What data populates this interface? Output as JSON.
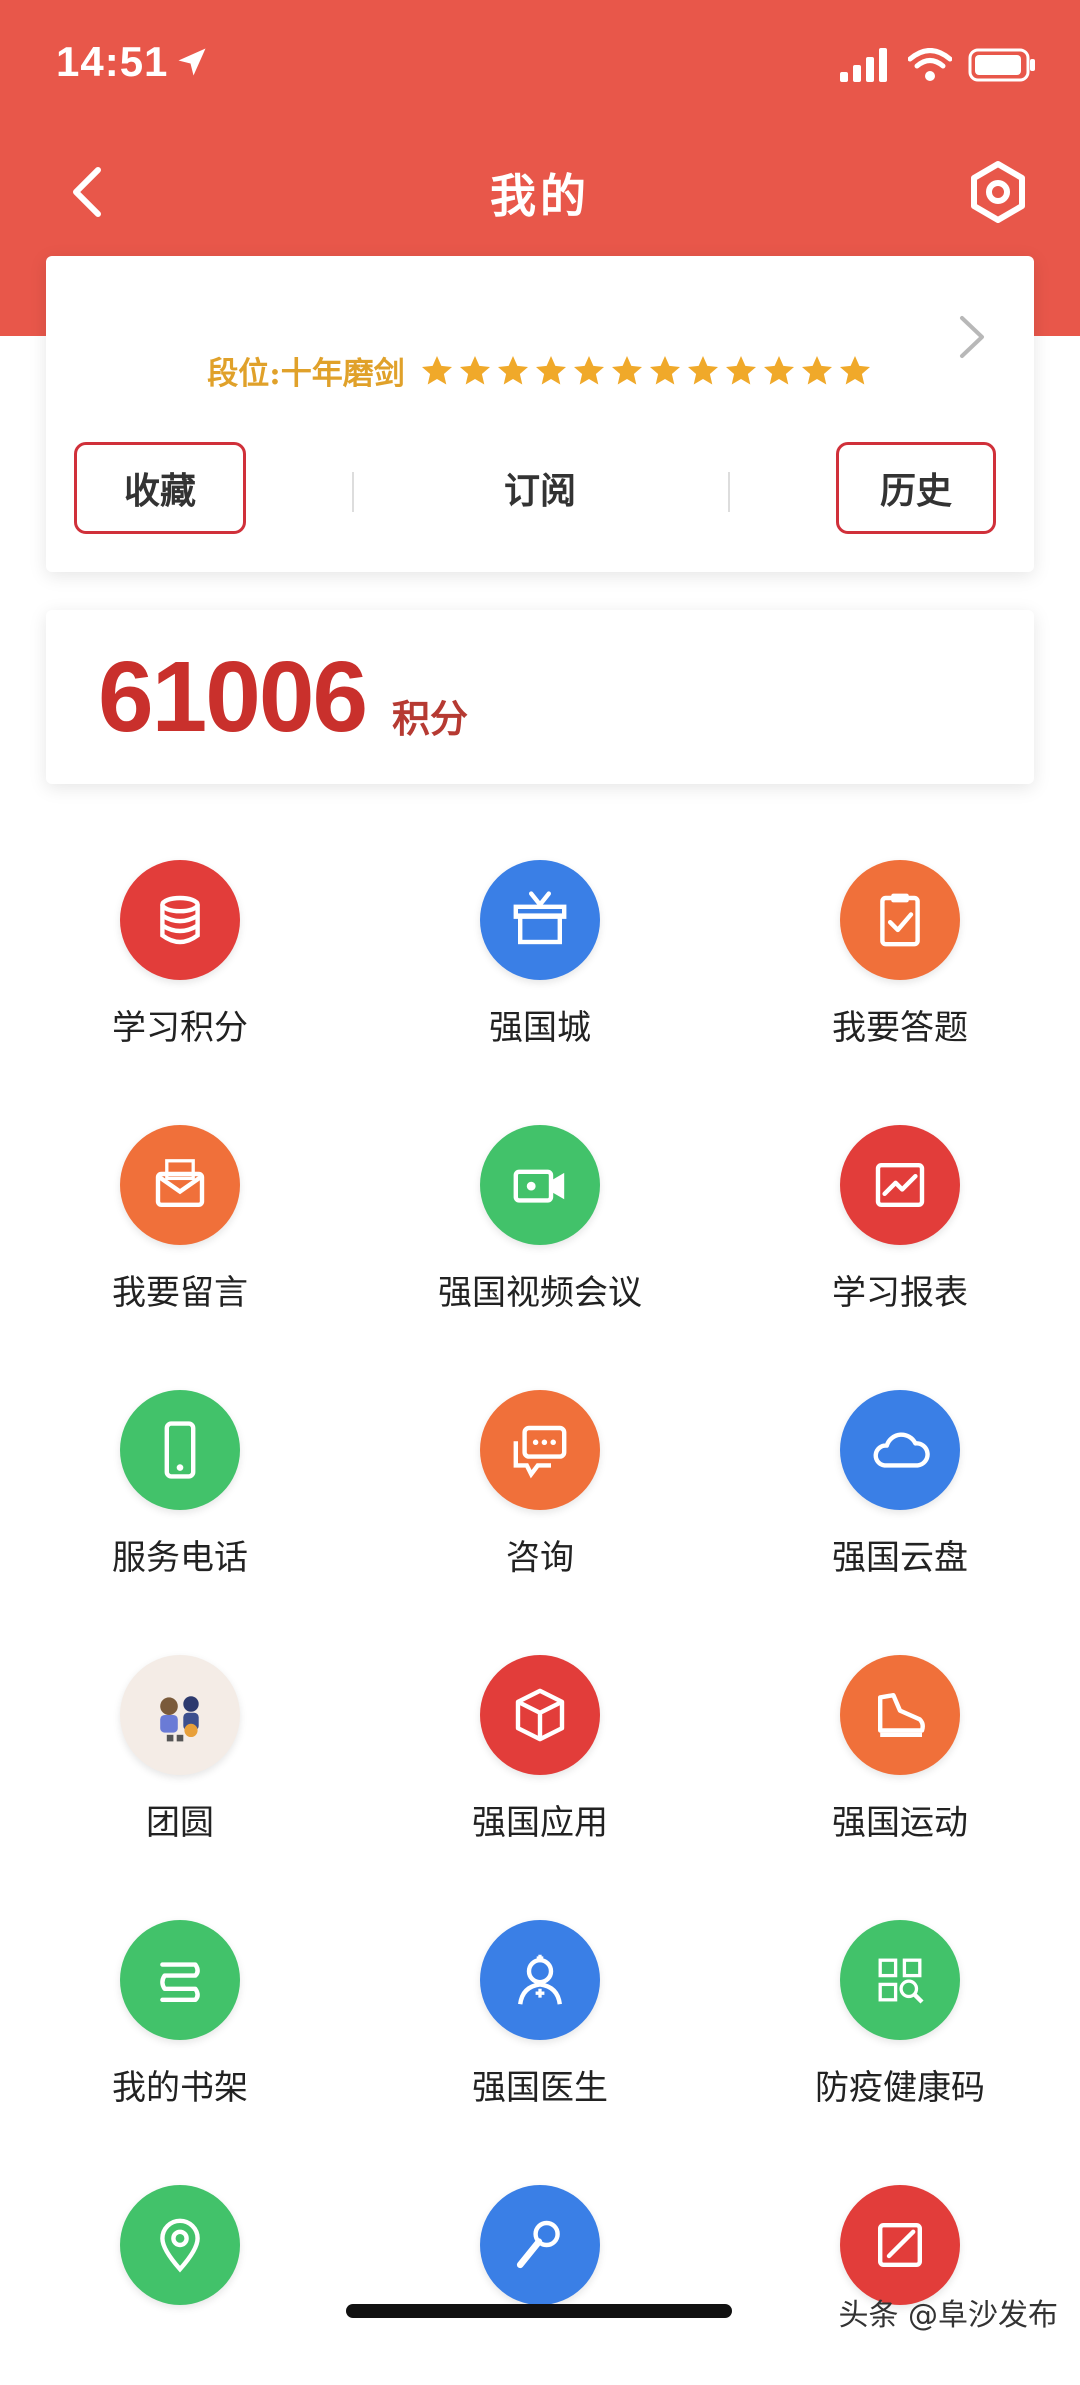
{
  "status": {
    "time": "14:51"
  },
  "nav": {
    "title": "我的"
  },
  "profile": {
    "rank_text": "段位:十年磨剑",
    "stars": 12,
    "quick": [
      {
        "label": "收藏"
      },
      {
        "label": "订阅"
      },
      {
        "label": "历史"
      }
    ]
  },
  "points": {
    "value": "61006",
    "unit": "积分"
  },
  "menu": [
    {
      "label": "学习积分",
      "icon": "database-icon",
      "color": "#e23d3a"
    },
    {
      "label": "强国城",
      "icon": "gift-box-icon",
      "color": "#3a7fe6"
    },
    {
      "label": "我要答题",
      "icon": "clipboard-check-icon",
      "color": "#f0703a"
    },
    {
      "label": "我要留言",
      "icon": "envelope-icon",
      "color": "#f0703a"
    },
    {
      "label": "强国视频会议",
      "icon": "video-camera-icon",
      "color": "#42c26a"
    },
    {
      "label": "学习报表",
      "icon": "chart-report-icon",
      "color": "#e23d3a"
    },
    {
      "label": "服务电话",
      "icon": "phone-icon",
      "color": "#42c26a"
    },
    {
      "label": "咨询",
      "icon": "chat-bubbles-icon",
      "color": "#f0703a"
    },
    {
      "label": "强国云盘",
      "icon": "cloud-icon",
      "color": "#3a7fe6"
    },
    {
      "label": "团圆",
      "icon": "family-illustration-icon",
      "color": "#f4ece6"
    },
    {
      "label": "强国应用",
      "icon": "cube-icon",
      "color": "#e23d3a"
    },
    {
      "label": "强国运动",
      "icon": "sneaker-icon",
      "color": "#f0703a"
    },
    {
      "label": "我的书架",
      "icon": "bookshelf-icon",
      "color": "#42c26a"
    },
    {
      "label": "强国医生",
      "icon": "doctor-icon",
      "color": "#3a7fe6"
    },
    {
      "label": "防疫健康码",
      "icon": "qr-scan-icon",
      "color": "#42c26a"
    },
    {
      "label": "",
      "icon": "location-pin-icon",
      "color": "#42c26a"
    },
    {
      "label": "",
      "icon": "microphone-icon",
      "color": "#3a7fe6"
    },
    {
      "label": "",
      "icon": "edit-icon",
      "color": "#e23d3a"
    }
  ],
  "watermark": "头条 @阜沙发布"
}
